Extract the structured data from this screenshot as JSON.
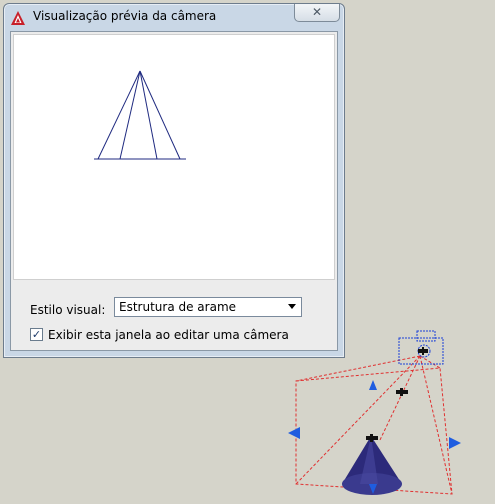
{
  "window": {
    "title": "Visualização prévia da câmera",
    "app_icon": "autocad-logo-icon",
    "close_icon": "close-icon",
    "close_glyph": "✕"
  },
  "form": {
    "visual_style_label": "Estilo visual:",
    "visual_style_value": "Estrutura de arame",
    "show_window_label": "Exibir esta janela ao editar uma câmera",
    "show_window_checked": true,
    "check_glyph": "✓"
  },
  "colors": {
    "wireframe": "#1f2a80",
    "camera_glyph": "#1a3fd8",
    "frustum": "#e03030",
    "grip": "#1f5de0",
    "cone_fill": "#2c2a7a"
  }
}
